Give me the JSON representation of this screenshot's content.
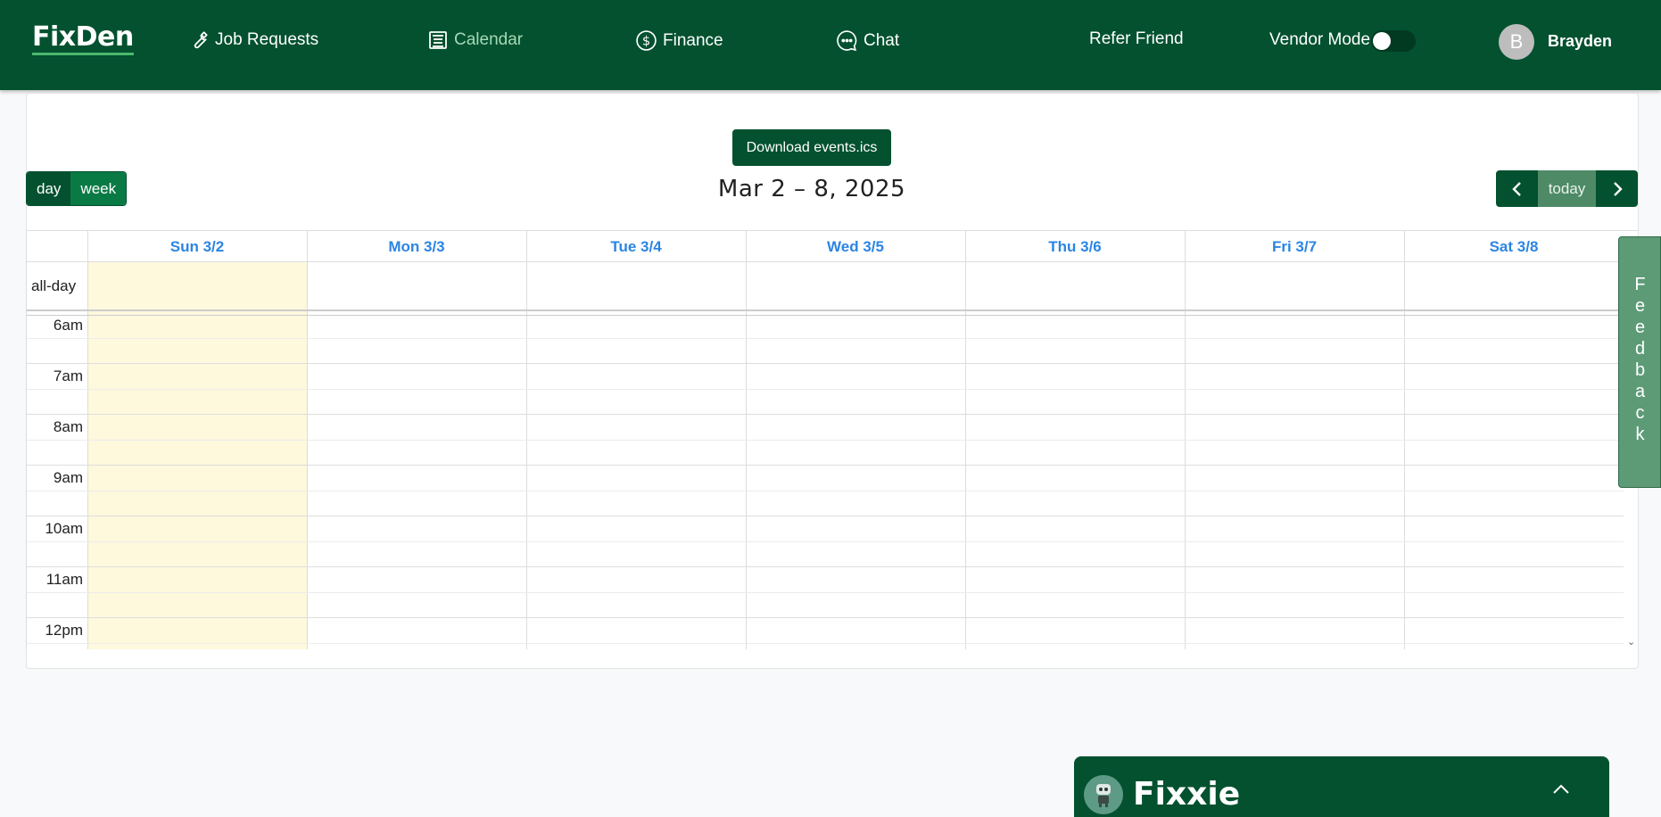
{
  "nav": {
    "logo": "FixDen",
    "items": [
      {
        "label": "Job Requests",
        "icon": "wrench-icon"
      },
      {
        "label": "Calendar",
        "icon": "calendar-icon"
      },
      {
        "label": "Finance",
        "icon": "dollar-icon"
      },
      {
        "label": "Chat",
        "icon": "chat-icon"
      }
    ],
    "refer": "Refer Friend",
    "vendor_mode": "Vendor Mode",
    "vendor_mode_on": false,
    "avatar_initial": "B",
    "username": "Brayden"
  },
  "calendar": {
    "download_label": "Download events.ics",
    "views": [
      "day",
      "week"
    ],
    "active_view": "week",
    "title": "Mar 2 – 8, 2025",
    "today_label": "today",
    "days": [
      "Sun 3/2",
      "Mon 3/3",
      "Tue 3/4",
      "Wed 3/5",
      "Thu 3/6",
      "Fri 3/7",
      "Sat 3/8"
    ],
    "allday_label": "all-day",
    "times": [
      "6am",
      "7am",
      "8am",
      "9am",
      "10am",
      "11am",
      "12pm"
    ]
  },
  "feedback": "Feedback",
  "fixxie": {
    "title": "Fixxie"
  },
  "colors": {
    "brand": "#03512f",
    "day_header": "#2b85e2",
    "today_highlight": "#fef8dd"
  }
}
